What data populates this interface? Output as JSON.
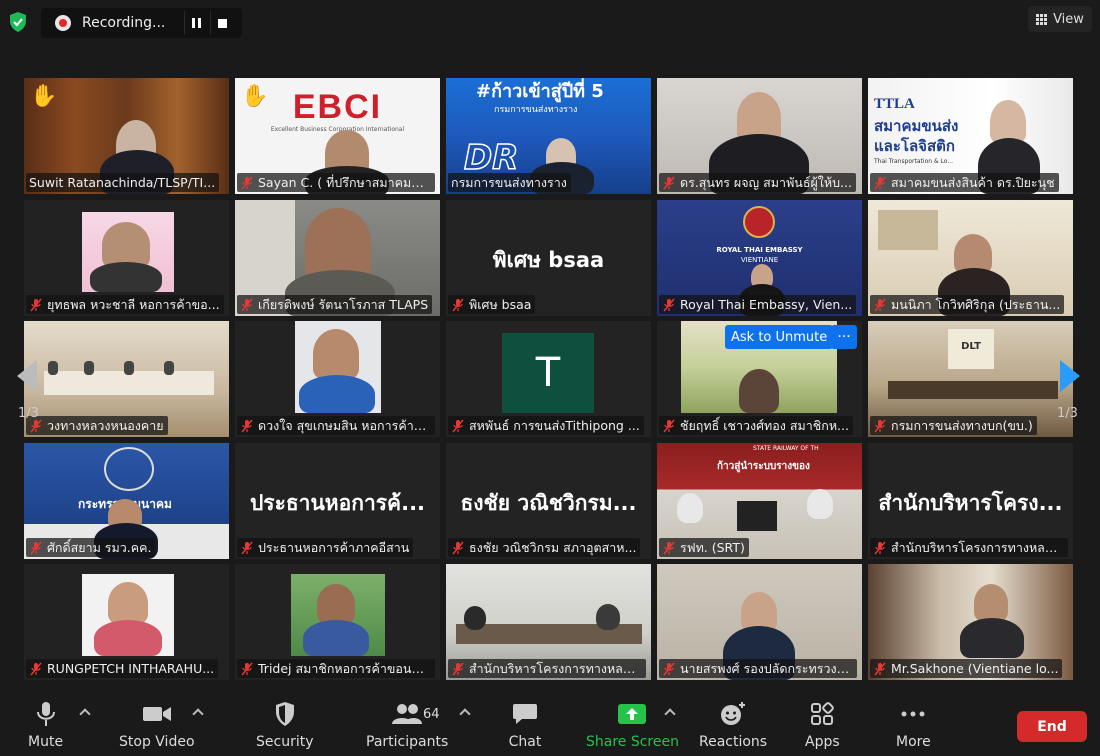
{
  "recording": {
    "label": "Recording..."
  },
  "view": {
    "label": "View"
  },
  "pagination": {
    "left": "1/3",
    "right": "1/3"
  },
  "colors": {
    "accent": "#0e72ed",
    "end": "#d42a2a",
    "active_speaker": "#e6e56a",
    "share": "#27c24c"
  },
  "tiles": [
    {
      "name": "Suwit Ratanachinda/TLSP/TI...",
      "big": "",
      "muted": false
    },
    {
      "name": "Sayan C. ( ที่ปรึกษาสมาคมข...",
      "big": "",
      "muted": true
    },
    {
      "name": "กรมการขนส่งทางราง",
      "big": "",
      "muted": false
    },
    {
      "name": "ดร.สุนทร ผจญ สมาพันธ์ผู้ให้บ...",
      "big": "",
      "muted": true
    },
    {
      "name": "สมาคมขนส่งสินค้า ดร.ปิยะนุช",
      "big": "",
      "muted": true
    },
    {
      "name": "ยุทธพล หวะชาลี หอการค้าขอ...",
      "big": "",
      "muted": true
    },
    {
      "name": "เกียรติพงษ์ รัตนาโรภาส  TLAPS",
      "big": "",
      "muted": true
    },
    {
      "name": "พิเศษ bsaa",
      "big": "พิเศษ bsaa",
      "muted": true
    },
    {
      "name": "Royal Thai Embassy, Vien...",
      "big": "",
      "muted": true
    },
    {
      "name": "มนนิภา โกวิทศิริกุล (ประธาน...",
      "big": "",
      "muted": true
    },
    {
      "name": "วงทางหลวงหนองคาย",
      "big": "",
      "muted": true
    },
    {
      "name": "ดวงใจ สุขเกษมสิน หอการค้าห...",
      "big": "",
      "muted": true
    },
    {
      "name": "สหพันธ์ การขนส่งTithipong ...",
      "big": "",
      "muted": true
    },
    {
      "name": "ชัยฤทธิ์ เชาวงศ์ทอง สมาชิกห...",
      "big": "",
      "muted": true
    },
    {
      "name": "กรมการขนส่งทางบก(ขบ.)",
      "big": "",
      "muted": true
    },
    {
      "name": "ศักดิ์สยาม รมว.คค.",
      "big": "",
      "muted": true
    },
    {
      "name": "ประธานหอการค้าภาคอีสาน",
      "big": "ประธานหอการค้...",
      "muted": true
    },
    {
      "name": "ธงชัย วณิชวิกรม สภาอุตสาห...",
      "big": "ธงชัย วณิชวิกรม...",
      "muted": true
    },
    {
      "name": "รฟท. (SRT)",
      "big": "",
      "muted": true
    },
    {
      "name": "สำนักบริหารโครงการทางหลวง...",
      "big": "สำนักบริหารโครง...",
      "muted": true
    },
    {
      "name": "RUNGPETCH INTHARAHU...",
      "big": "",
      "muted": true
    },
    {
      "name": "Tridej สมาชิกหอการค้าขอนแ...",
      "big": "",
      "muted": true
    },
    {
      "name": "สำนักบริหารโครงการทางหลวง...",
      "big": "",
      "muted": true
    },
    {
      "name": "นายสรพงศ์ รองปลัดกระทรวงคมน...",
      "big": "",
      "muted": true
    },
    {
      "name": "Mr.Sakhone (Vientiane lo...",
      "big": "",
      "muted": true
    }
  ],
  "overlays": {
    "ebci": "EBCI",
    "ebci_sub": "Excellent Business Corporation International",
    "ttla": "TTLA",
    "ttla_line1": "สมาคมขนส่ง",
    "ttla_line2": "และโลจิสติก",
    "ttla_sub": "Thai Transportation & Lo...",
    "rail_hashtag": "#ก้าวเข้าสู่ปีที่ 5",
    "rail_dept": "กรมการขนส่งทางราง",
    "rail_logo": "DR",
    "embassy_line1": "ROYAL THAI EMBASSY",
    "embassy_line2": "VIENTIANE",
    "ministry_sign": "กระทรวงคมนาคม",
    "dlt": "DLT",
    "srt_sign": "STATE RAILWAY OF TH",
    "srt_slogan": "ก้าวสู่นำระบบรางของ",
    "avatar_letter": "T",
    "ask_unmute": "Ask to Unmute",
    "more": "···"
  },
  "toolbar": {
    "mute": "Mute",
    "stop_video": "Stop Video",
    "security": "Security",
    "participants": "Participants",
    "participants_count": "64",
    "chat": "Chat",
    "share_screen": "Share Screen",
    "reactions": "Reactions",
    "apps": "Apps",
    "more": "More",
    "end": "End"
  }
}
